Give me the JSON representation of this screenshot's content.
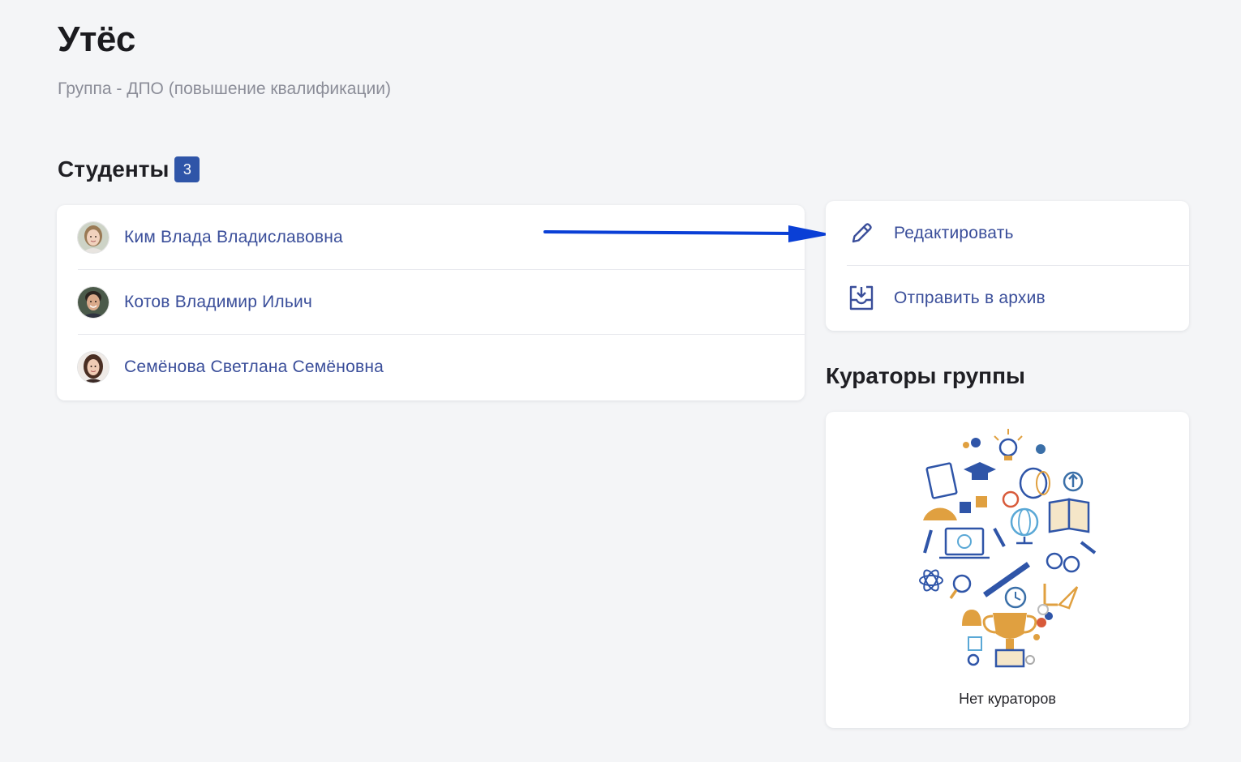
{
  "header": {
    "title": "Утёс",
    "subtitle": "Группа - ДПО (повышение квалификации)"
  },
  "students": {
    "title": "Студенты",
    "count": "3",
    "items": [
      {
        "name": "Ким Влада Владиславовна"
      },
      {
        "name": "Котов Владимир Ильич"
      },
      {
        "name": "Семёнова Светлана Семёновна"
      }
    ]
  },
  "actions": {
    "edit_label": "Редактировать",
    "archive_label": "Отправить в архив"
  },
  "curators": {
    "title": "Кураторы группы",
    "empty_text": "Нет кураторов"
  },
  "colors": {
    "accent": "#2f55a8",
    "link": "#3a4e9a",
    "annotation_arrow": "#0a3fd6"
  }
}
